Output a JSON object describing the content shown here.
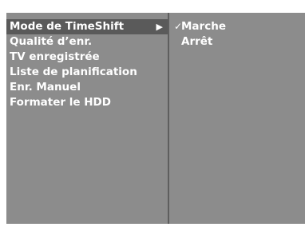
{
  "menu": {
    "items": [
      {
        "label": "Mode de TimeShift",
        "arrow": "▶"
      },
      {
        "label": "Qualité d’enr."
      },
      {
        "label": "TV enregistrée"
      },
      {
        "label": "Liste de planification"
      },
      {
        "label": "Enr. Manuel"
      },
      {
        "label": "Formater le HDD"
      }
    ]
  },
  "submenu": {
    "options": [
      {
        "label": "Marche",
        "check": "✓"
      },
      {
        "label": "Arrêt"
      }
    ]
  },
  "colors": {
    "panel": "#8c8c8c",
    "highlight": "#5a5a5a",
    "divider": "#5e5e5e",
    "text": "#ffffff"
  }
}
